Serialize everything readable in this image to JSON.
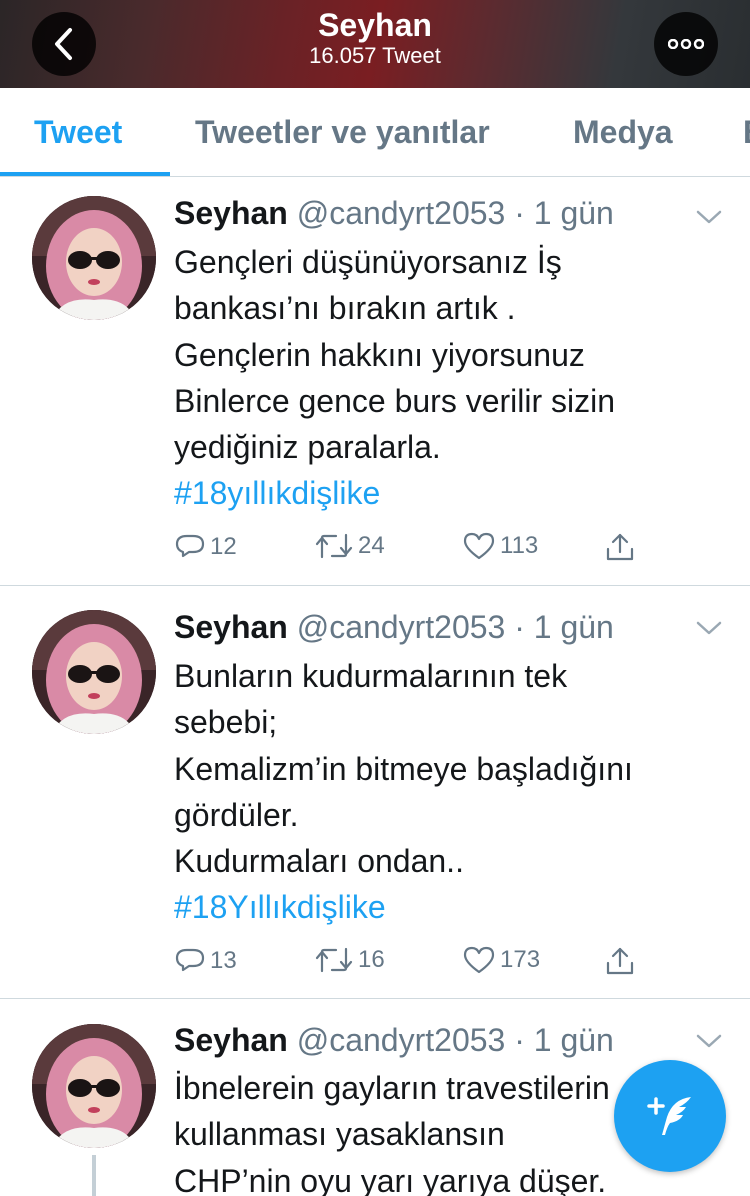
{
  "header": {
    "title": "Seyhan",
    "subtitle": "16.057 Tweet",
    "back_icon": "chevron-left-icon",
    "more_icon": "more-horizontal-icon"
  },
  "tabs": [
    {
      "label": "Tweet",
      "active": true
    },
    {
      "label": "Tweetler ve yanıtlar",
      "active": false
    },
    {
      "label": "Medya",
      "active": false
    },
    {
      "label": "B",
      "active": false
    }
  ],
  "tweets": [
    {
      "name": "Seyhan",
      "handle": "@candyrt2053",
      "time": "· 1 gün",
      "lines": [
        "Gençleri düşünüyorsanız İş",
        "bankası’nı bırakın artık .",
        "Gençlerin hakkını yiyorsunuz",
        "Binlerce gence burs verilir sizin",
        "yediğiniz paralarla."
      ],
      "hashtag": "#18yıllıkdişlike",
      "replies": "12",
      "retweets": "24",
      "likes": "113"
    },
    {
      "name": "Seyhan",
      "handle": "@candyrt2053",
      "time": "· 1 gün",
      "lines": [
        "Bunların kudurmalarının tek",
        "sebebi;",
        "Kemalizm’in bitmeye başladığını",
        "gördüler.",
        "Kudurmaları ondan.."
      ],
      "hashtag": "#18Yıllıkdişlike",
      "replies": "13",
      "retweets": "16",
      "likes": "173"
    },
    {
      "name": "Seyhan",
      "handle": "@candyrt2053",
      "time": "· 1 gün",
      "lines": [
        "İbnelerein gayların travestilerin",
        "kullanması yasaklansın",
        "CHP’nin oyu yarı yarıya düşer."
      ]
    }
  ],
  "colors": {
    "accent": "#1da1f2",
    "secondary_text": "#657786",
    "divider": "#cfd9de"
  },
  "icons": {
    "reply": "reply-icon",
    "retweet": "retweet-icon",
    "like": "heart-icon",
    "share": "share-icon",
    "caret": "chevron-down-icon",
    "compose": "compose-tweet-icon"
  }
}
